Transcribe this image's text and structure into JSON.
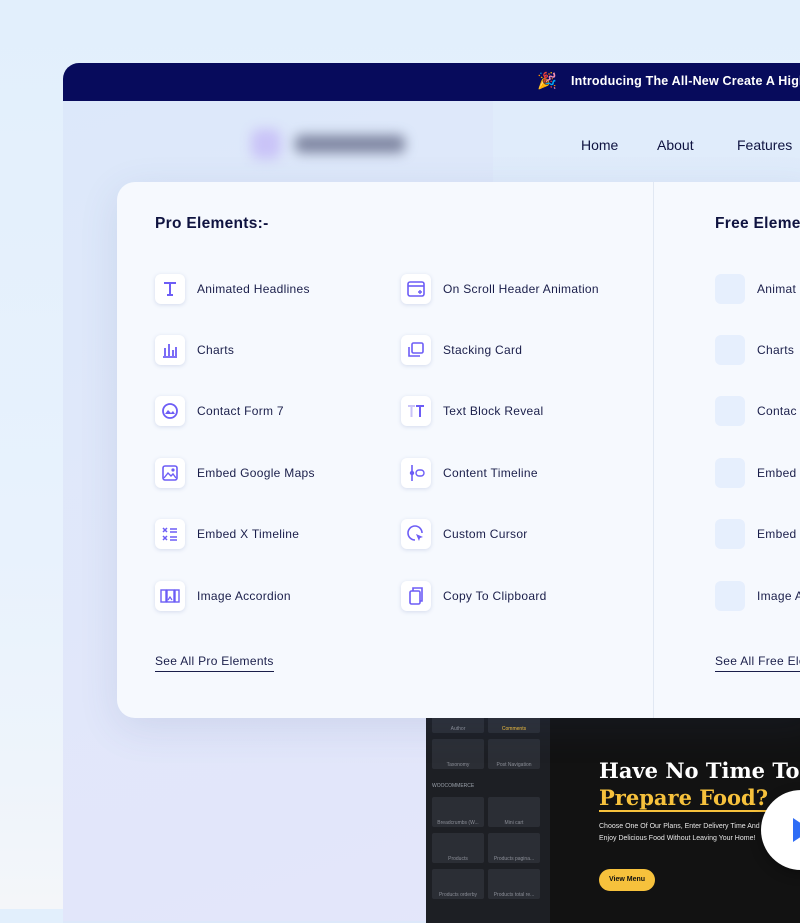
{
  "announcement": {
    "icon": "party-popper-icon",
    "text": "Introducing The All-New Create A High-"
  },
  "nav": {
    "items": [
      "Home",
      "About",
      "Features"
    ]
  },
  "pro": {
    "title": "Pro Elements:-",
    "items": [
      {
        "label": "Animated Headlines",
        "icon": "animated-headline-icon"
      },
      {
        "label": "Charts",
        "icon": "chart-icon"
      },
      {
        "label": "Contact Form 7",
        "icon": "contact-form-icon"
      },
      {
        "label": "Embed Google Maps",
        "icon": "map-icon"
      },
      {
        "label": "Embed X Timeline",
        "icon": "x-timeline-icon"
      },
      {
        "label": "Image Accordion",
        "icon": "image-accordion-icon"
      },
      {
        "label": "On Scroll Header Animation",
        "icon": "scroll-header-icon"
      },
      {
        "label": "Stacking Card",
        "icon": "stacking-card-icon"
      },
      {
        "label": "Text Block Reveal",
        "icon": "text-reveal-icon"
      },
      {
        "label": "Content Timeline",
        "icon": "timeline-icon"
      },
      {
        "label": "Custom Cursor",
        "icon": "cursor-icon"
      },
      {
        "label": "Copy To Clipboard",
        "icon": "clipboard-icon"
      }
    ],
    "see_all": "See All Pro Elements"
  },
  "free": {
    "title": "Free Eleme",
    "items": [
      {
        "label": "Animat"
      },
      {
        "label": "Charts"
      },
      {
        "label": "Contac"
      },
      {
        "label": "Embed"
      },
      {
        "label": "Embed"
      },
      {
        "label": "Image A"
      }
    ],
    "see_all": "See All Free Ele"
  },
  "preview": {
    "sidebar_tiles": [
      "Author",
      "Comments",
      "Taxonomy",
      "Post Navigation",
      "Breadcrumbs (W...",
      "Mini cart",
      "Products",
      "Products pagina...",
      "Products orderby",
      "Products total re..."
    ],
    "sidebar_heading": "WOOCOMMERCE",
    "title_line1": "Have No Time To",
    "title_line2": "Prepare Food?",
    "body": "Choose One Of Our Plans, Enter Delivery Time And Enjoy Delicious Food Without Leaving Your Home!",
    "button": "View Menu"
  },
  "colors": {
    "topbar": "#070b5c",
    "accent": "#6d5df6",
    "text": "#0f1340",
    "preview_accent": "#f6c13c"
  }
}
